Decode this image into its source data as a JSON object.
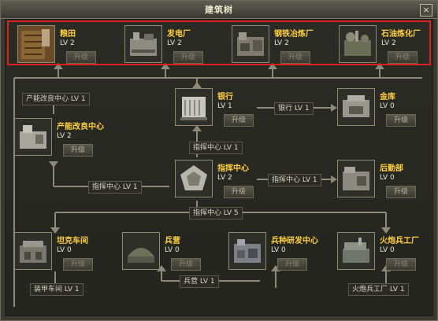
{
  "window": {
    "title": "建筑树",
    "close_label": "×"
  },
  "buttons": {
    "upgrade": "升级"
  },
  "colors": {
    "highlight": "#e01f1f",
    "name": "#ffcf40",
    "line": "#8c8a78"
  },
  "top_row": [
    {
      "name": "粮田",
      "level": "LV 2",
      "icon": "farm-icon"
    },
    {
      "name": "发电厂",
      "level": "LV 2",
      "icon": "power-plant-icon"
    },
    {
      "name": "钢铁冶炼厂",
      "level": "LV 2",
      "icon": "steel-mill-icon"
    },
    {
      "name": "石油炼化厂",
      "level": "LV 2",
      "icon": "oil-refinery-icon"
    }
  ],
  "middle": {
    "bank": {
      "name": "银行",
      "level": "LV 1",
      "icon": "bank-icon"
    },
    "vault": {
      "name": "金库",
      "level": "LV 0",
      "icon": "vault-icon"
    },
    "energy": {
      "name": "产能改良中心",
      "level": "LV 2",
      "icon": "energy-center-icon"
    },
    "hq": {
      "name": "指挥中心",
      "level": "LV 2",
      "icon": "hq-icon"
    },
    "logistics": {
      "name": "后勤部",
      "level": "LV 0",
      "icon": "logistics-icon"
    }
  },
  "bottom_row": [
    {
      "name": "坦克车间",
      "level": "LV 0",
      "icon": "tank-workshop-icon"
    },
    {
      "name": "兵营",
      "level": "LV 0",
      "icon": "barracks-icon"
    },
    {
      "name": "兵种研发中心",
      "level": "LV 0",
      "icon": "research-center-icon"
    },
    {
      "name": "火炮兵工厂",
      "level": "LV 0",
      "icon": "artillery-factory-icon"
    }
  ],
  "links": {
    "energy_req": "产能改良中心 LV 1",
    "bank_req": "银行 LV 1",
    "hq_req_bank": "指挥中心 LV 1",
    "hq_req_energy": "指挥中心 LV 1",
    "hq_req_logistics": "指挥中心 LV 1",
    "hq_req_bottom": "指挥中心 LV 5",
    "tank_req": "装甲车间 LV 1",
    "barracks_req": "兵营 LV 1",
    "artillery_req": "火炮兵工厂 LV 1"
  }
}
